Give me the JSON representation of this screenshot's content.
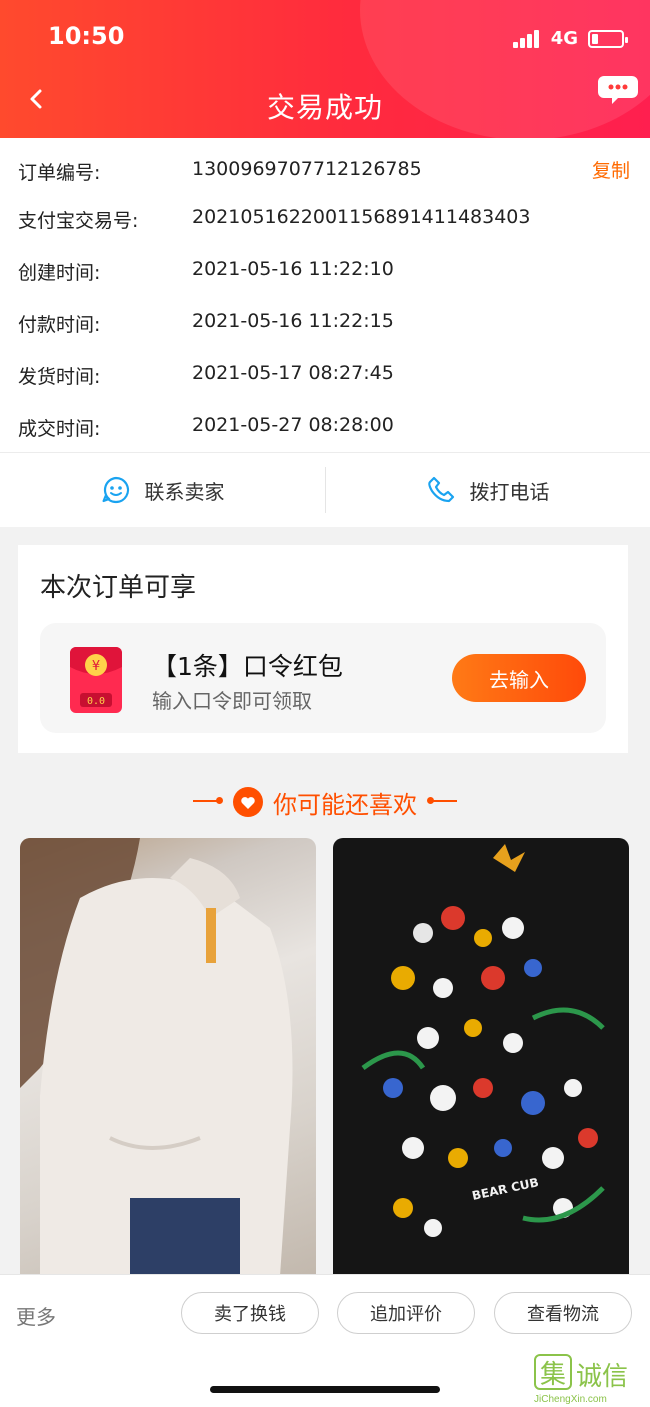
{
  "status_bar": {
    "time": "10:50",
    "network": "4G"
  },
  "header": {
    "title": "交易成功"
  },
  "order_info": {
    "copy_label": "复制",
    "rows": [
      {
        "label": "订单编号:",
        "value": "1300969707712126785"
      },
      {
        "label": "支付宝交易号:",
        "value": "2021051622001156891411483403"
      },
      {
        "label": "创建时间:",
        "value": "2021-05-16 11:22:10"
      },
      {
        "label": "付款时间:",
        "value": "2021-05-16 11:22:15"
      },
      {
        "label": "发货时间:",
        "value": "2021-05-17 08:27:45"
      },
      {
        "label": "成交时间:",
        "value": "2021-05-27 08:28:00"
      }
    ]
  },
  "contact": {
    "seller_label": "联系卖家",
    "phone_label": "拨打电话"
  },
  "benefit": {
    "title": "本次订单可享",
    "coupon_title": "【1条】口令红包",
    "coupon_desc": "输入口令即可领取",
    "button_label": "去输入"
  },
  "recommend": {
    "title": "你可能还喜欢",
    "image_text": "BEAR CUB"
  },
  "bottom_bar": {
    "more_label": "更多",
    "buttons": [
      "卖了换钱",
      "追加评价",
      "查看物流"
    ]
  },
  "watermark": {
    "text": "诚信",
    "sub": "JiChengXin.com"
  },
  "colors": {
    "header_start": "#ff4a2d",
    "header_end": "#ff1f4f",
    "accent": "#ff6a00",
    "contact_icon": "#1aa3f0"
  },
  "icons": [
    "back-icon",
    "chat-bubble-icon",
    "smiley-chat-icon",
    "phone-icon",
    "red-packet-icon",
    "heart-icon"
  ]
}
